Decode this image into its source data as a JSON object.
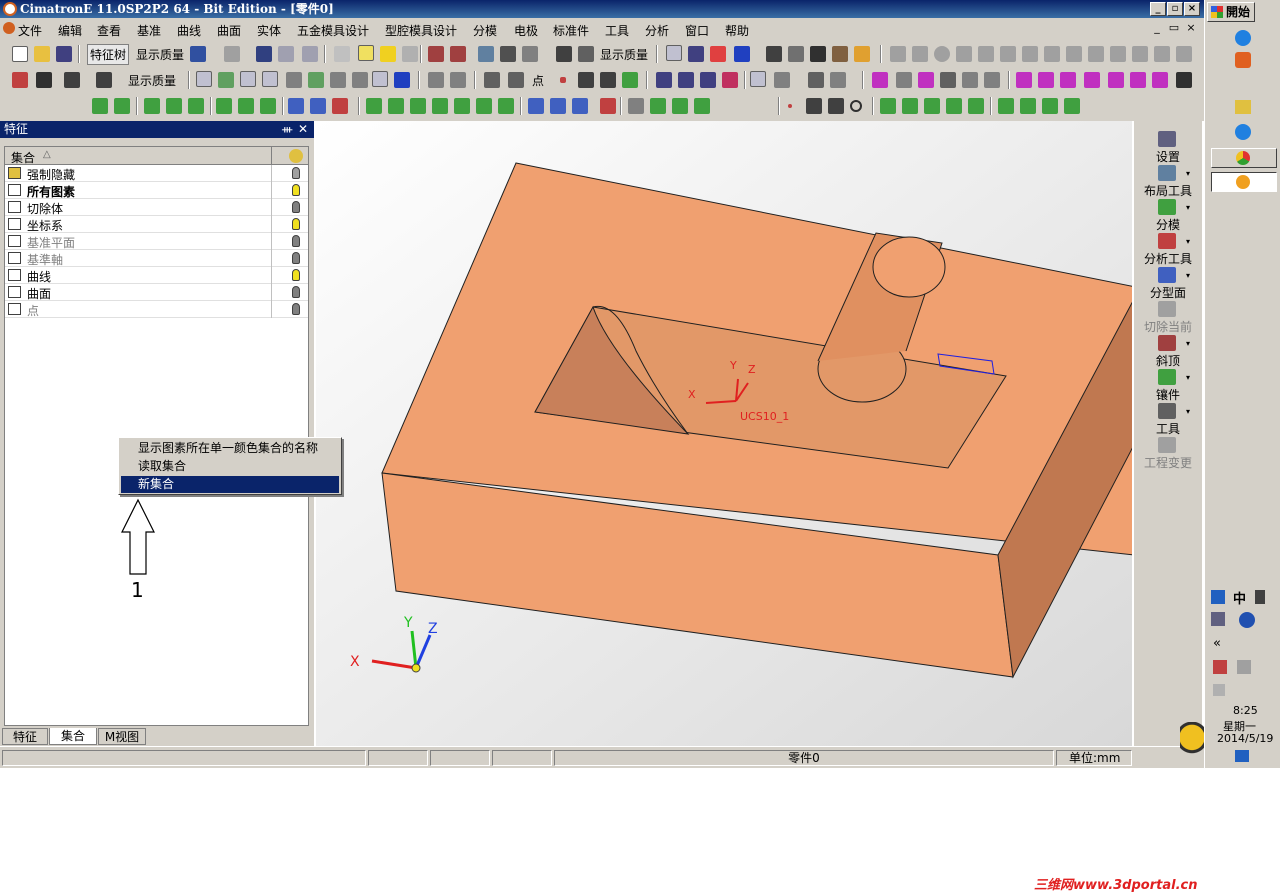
{
  "window": {
    "title": "CimatronE 11.0SP2P2 64 - Bit Edition - [零件0]"
  },
  "menu": {
    "items": [
      "文件",
      "编辑",
      "查看",
      "基准",
      "曲线",
      "曲面",
      "实体",
      "五金模具设计",
      "型腔模具设计",
      "分模",
      "电极",
      "标准件",
      "工具",
      "分析",
      "窗口",
      "帮助"
    ]
  },
  "toolbar": {
    "feature_tree_label": "特征树",
    "display_quality_label": "显示质量",
    "point_label": "点"
  },
  "panel": {
    "title": "特征",
    "header": "集合",
    "sort_mark": "△",
    "items": [
      {
        "label": "强制隐藏",
        "bold": false,
        "dim": false,
        "bulb": "#a0a0a0"
      },
      {
        "label": "所有图素",
        "bold": true,
        "dim": false,
        "bulb": "#f0e020"
      },
      {
        "label": "切除体",
        "bold": false,
        "dim": false,
        "bulb": "#808080"
      },
      {
        "label": "坐标系",
        "bold": false,
        "dim": false,
        "bulb": "#f0e020"
      },
      {
        "label": "基准平面",
        "bold": false,
        "dim": true,
        "bulb": "#808080"
      },
      {
        "label": "基準軸",
        "bold": false,
        "dim": true,
        "bulb": "#808080"
      },
      {
        "label": "曲线",
        "bold": false,
        "dim": false,
        "bulb": "#f0e020"
      },
      {
        "label": "曲面",
        "bold": false,
        "dim": false,
        "bulb": "#808080"
      },
      {
        "label": "点",
        "bold": false,
        "dim": true,
        "bulb": "#808080"
      }
    ],
    "tabs": [
      "特征",
      "集合",
      "M视图"
    ]
  },
  "context_menu": {
    "items": [
      "显示图素所在单一颜色集合的名称",
      "读取集合",
      "新集合"
    ],
    "selected_index": 2
  },
  "annotation": {
    "label": "1"
  },
  "viewport": {
    "ucs_label": "UCS10_1",
    "axis_x": "X",
    "axis_y": "Y",
    "axis_z": "Z",
    "model_color": "#f0a070"
  },
  "rightbar": {
    "items": [
      "设置",
      "布局工具",
      "分模",
      "分析工具",
      "分型面",
      "切除当前",
      "斜顶",
      "镶件",
      "工具",
      "工程变更"
    ]
  },
  "status": {
    "part": "零件0",
    "unit": "单位:mm"
  },
  "taskbar": {
    "start_label": "開始",
    "ime_label": "中",
    "time": "8:25",
    "weekday": "星期一",
    "date": "2014/5/19",
    "collapse": "«"
  },
  "watermark": {
    "text": "三维网www.3dportal.cn"
  }
}
